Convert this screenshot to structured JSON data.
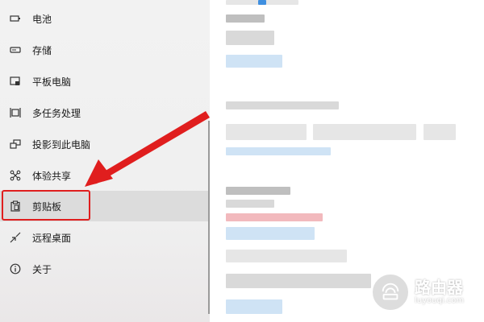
{
  "sidebar": {
    "items": [
      {
        "label": "电池",
        "icon": "battery-icon"
      },
      {
        "label": "存储",
        "icon": "storage-icon"
      },
      {
        "label": "平板电脑",
        "icon": "tablet-icon"
      },
      {
        "label": "多任务处理",
        "icon": "multitasking-icon"
      },
      {
        "label": "投影到此电脑",
        "icon": "projection-icon"
      },
      {
        "label": "体验共享",
        "icon": "shared-experiences-icon"
      },
      {
        "label": "剪贴板",
        "icon": "clipboard-icon"
      },
      {
        "label": "远程桌面",
        "icon": "remote-desktop-icon"
      },
      {
        "label": "关于",
        "icon": "info-icon"
      }
    ],
    "selected_index": 6
  },
  "watermark": {
    "title": "路由器",
    "subtitle": "luyouqi.com"
  },
  "colors": {
    "highlight": "#e01e1e",
    "arrow": "#e01e1e",
    "accent": "#3f8fe0",
    "selected_bg": "#dcdcdc"
  }
}
